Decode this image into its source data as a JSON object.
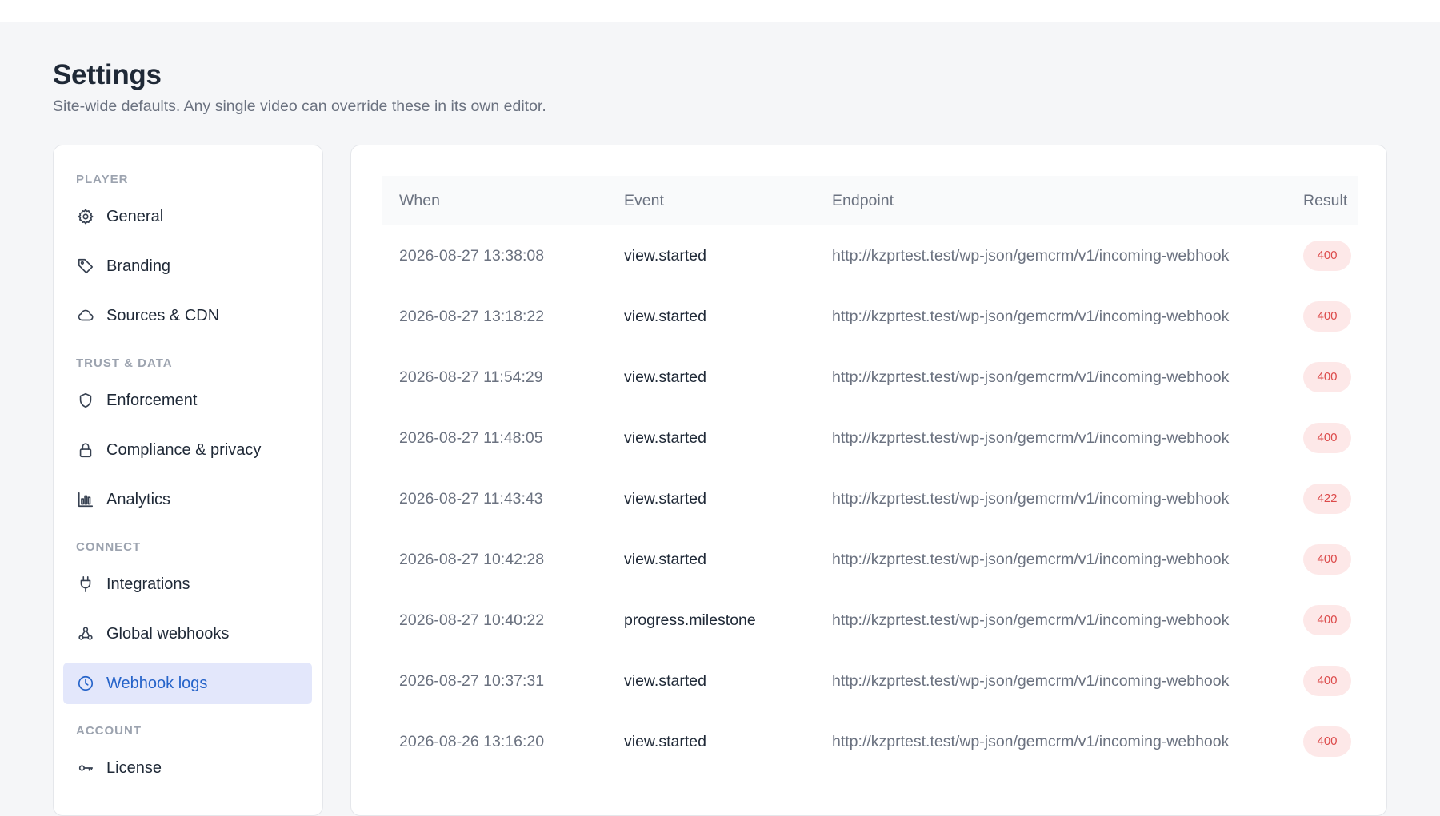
{
  "header": {
    "title": "Settings",
    "subtitle": "Site-wide defaults. Any single video can override these in its own editor."
  },
  "sidebar": {
    "sections": [
      {
        "label": "PLAYER"
      },
      {
        "label": "TRUST & DATA"
      },
      {
        "label": "CONNECT"
      },
      {
        "label": "ACCOUNT"
      }
    ],
    "items": [
      {
        "label": "General",
        "icon": "gear-icon"
      },
      {
        "label": "Branding",
        "icon": "tag-icon"
      },
      {
        "label": "Sources & CDN",
        "icon": "cloud-icon"
      },
      {
        "label": "Enforcement",
        "icon": "shield-icon"
      },
      {
        "label": "Compliance & privacy",
        "icon": "lock-icon"
      },
      {
        "label": "Analytics",
        "icon": "bar-chart-icon"
      },
      {
        "label": "Integrations",
        "icon": "plug-icon"
      },
      {
        "label": "Global webhooks",
        "icon": "webhook-icon"
      },
      {
        "label": "Webhook logs",
        "icon": "clock-icon",
        "active": true
      },
      {
        "label": "License",
        "icon": "key-icon"
      }
    ]
  },
  "table": {
    "columns": [
      "When",
      "Event",
      "Endpoint",
      "Result"
    ],
    "rows": [
      {
        "when": "2026-08-27 13:38:08",
        "event": "view.started",
        "endpoint": "http://kzprtest.test/wp-json/gemcrm/v1/incoming-webhook",
        "result": "400"
      },
      {
        "when": "2026-08-27 13:18:22",
        "event": "view.started",
        "endpoint": "http://kzprtest.test/wp-json/gemcrm/v1/incoming-webhook",
        "result": "400"
      },
      {
        "when": "2026-08-27 11:54:29",
        "event": "view.started",
        "endpoint": "http://kzprtest.test/wp-json/gemcrm/v1/incoming-webhook",
        "result": "400"
      },
      {
        "when": "2026-08-27 11:48:05",
        "event": "view.started",
        "endpoint": "http://kzprtest.test/wp-json/gemcrm/v1/incoming-webhook",
        "result": "400"
      },
      {
        "when": "2026-08-27 11:43:43",
        "event": "view.started",
        "endpoint": "http://kzprtest.test/wp-json/gemcrm/v1/incoming-webhook",
        "result": "422"
      },
      {
        "when": "2026-08-27 10:42:28",
        "event": "view.started",
        "endpoint": "http://kzprtest.test/wp-json/gemcrm/v1/incoming-webhook",
        "result": "400"
      },
      {
        "when": "2026-08-27 10:40:22",
        "event": "progress.milestone",
        "endpoint": "http://kzprtest.test/wp-json/gemcrm/v1/incoming-webhook",
        "result": "400"
      },
      {
        "when": "2026-08-27 10:37:31",
        "event": "view.started",
        "endpoint": "http://kzprtest.test/wp-json/gemcrm/v1/incoming-webhook",
        "result": "400"
      },
      {
        "when": "2026-08-26 13:16:20",
        "event": "view.started",
        "endpoint": "http://kzprtest.test/wp-json/gemcrm/v1/incoming-webhook",
        "result": "400"
      }
    ]
  },
  "colors": {
    "accent": "#2563c9",
    "active_bg": "#e3e7fb",
    "error_badge_bg": "#fde8e8",
    "error_badge_text": "#dc4a4a"
  }
}
